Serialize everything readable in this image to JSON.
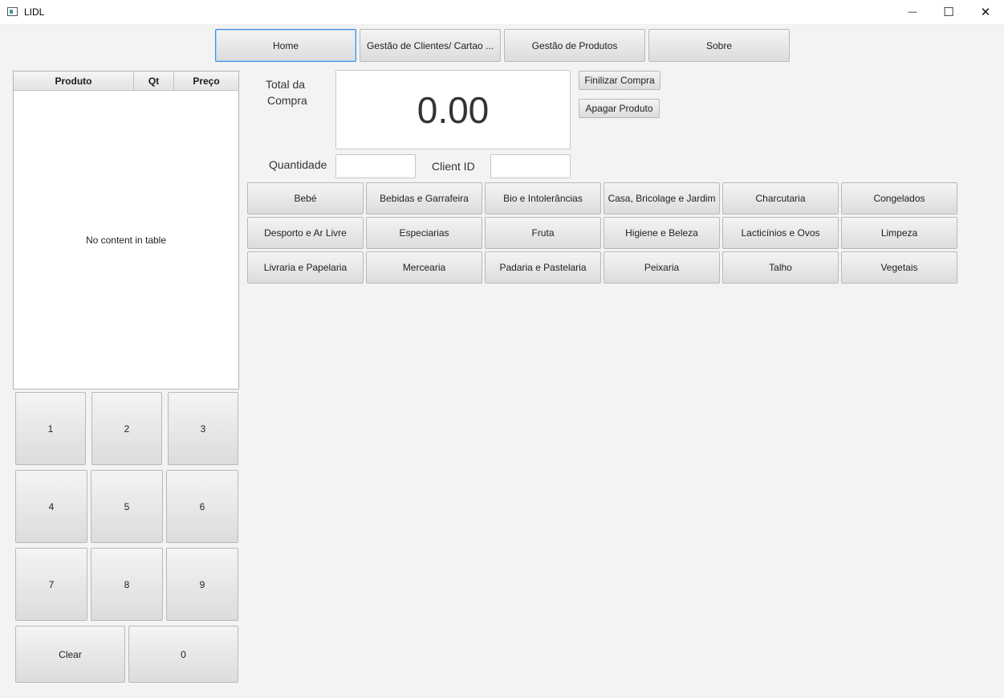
{
  "window": {
    "title": "LIDL",
    "minimize_glyph": "—",
    "maximize_glyph": "☐",
    "close_glyph": "✕"
  },
  "nav": [
    {
      "label": "Home",
      "active": true
    },
    {
      "label": "Gestão de Clientes/ Cartao ...",
      "active": false
    },
    {
      "label": "Gestão de Produtos",
      "active": false
    },
    {
      "label": "Sobre",
      "active": false
    }
  ],
  "cart_table": {
    "columns": [
      "Produto",
      "Qt",
      "Preço"
    ],
    "empty_text": "No content in table"
  },
  "total": {
    "label_line1": "Total da",
    "label_line2": "Compra",
    "value": "0.00"
  },
  "actions": {
    "finalize": "Finilizar Compra",
    "delete": "Apagar Produto"
  },
  "form": {
    "quantity_label": "Quantidade",
    "quantity_value": "",
    "client_label": "Client ID",
    "client_value": ""
  },
  "categories": [
    "Bebé",
    "Bebidas e Garrafeira",
    "Bio e Intolerâncias",
    "Casa, Bricolage e Jardim",
    "Charcutaria",
    "Congelados",
    "Desporto e Ar Livre",
    "Especiarias",
    "Fruta",
    "Higiene e Beleza",
    "Lacticínios e Ovos",
    "Limpeza",
    "Livraria e Papelaria",
    "Mercearia",
    "Padaria e Pastelaria",
    "Peixaria",
    "Talho",
    "Vegetais"
  ],
  "keypad": [
    "1",
    "2",
    "3",
    "4",
    "5",
    "6",
    "7",
    "8",
    "9",
    "Clear",
    "0"
  ]
}
